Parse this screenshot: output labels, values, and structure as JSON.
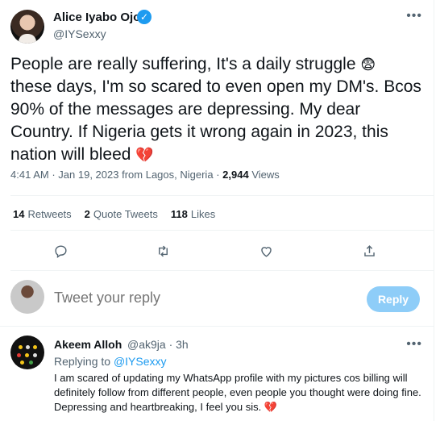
{
  "author": {
    "name": "Alice Iyabo Ojo",
    "handle": "@IYSexxy",
    "verified_mark": "✓"
  },
  "tweet": {
    "text": "People are really suffering, It's a daily struggle",
    "text_2": "these days,  I'm so scared to even open my DM's. Bcos 90% of the messages are depressing. My dear Country. If Nigeria gets it wrong again in 2023, this nation will bleed",
    "emoji_fear": "😨",
    "emoji_broken_heart": "💔",
    "time": "4:41 AM",
    "date": "Jan 19, 2023",
    "location": "from Lagos, Nigeria",
    "views_count": "2,944",
    "views_label": "Views",
    "sep": "·"
  },
  "stats": {
    "retweets_count": "14",
    "retweets_label": "Retweets",
    "quotes_count": "2",
    "quotes_label": "Quote Tweets",
    "likes_count": "118",
    "likes_label": "Likes"
  },
  "reply_box": {
    "placeholder": "Tweet your reply",
    "button": "Reply"
  },
  "reply": {
    "name": "Akeem Alloh",
    "handle": "@ak9ja",
    "sep": "·",
    "time": "3h",
    "replying_prefix": "Replying to",
    "replying_to": "@IYSexxy",
    "text": "I am scared of updating my WhatsApp profile with my pictures cos billing will definitely follow from different people, even people you thought were doing fine. Depressing and heartbreaking, I feel you sis.",
    "emoji": "💔"
  },
  "icons": {
    "more": "more-icon",
    "reply": "reply-icon",
    "retweet": "retweet-icon",
    "like": "heart-icon",
    "share": "share-icon"
  },
  "colors": {
    "accent": "#1d9bf0",
    "reply_button": "#8ecdf8",
    "secondary_text": "#536471"
  }
}
